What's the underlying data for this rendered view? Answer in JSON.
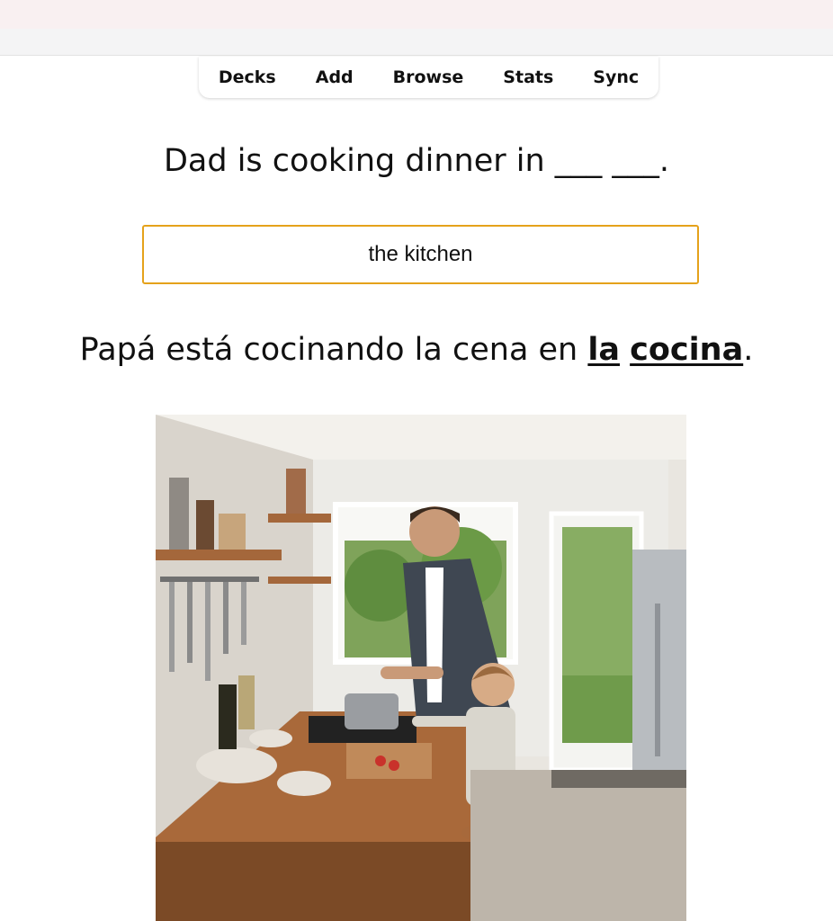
{
  "nav": {
    "items": [
      {
        "label": "Decks"
      },
      {
        "label": "Add"
      },
      {
        "label": "Browse"
      },
      {
        "label": "Stats"
      },
      {
        "label": "Sync"
      }
    ]
  },
  "card": {
    "question": "Dad is cooking dinner in ___ ___.",
    "typed_answer": "the kitchen",
    "translation": {
      "before": "Papá está cocinando la cena en ",
      "word1": "la",
      "word2": "cocina",
      "after": "."
    }
  },
  "colors": {
    "answer_border": "#e5a21b",
    "titlebar": "#f9f0f1"
  }
}
